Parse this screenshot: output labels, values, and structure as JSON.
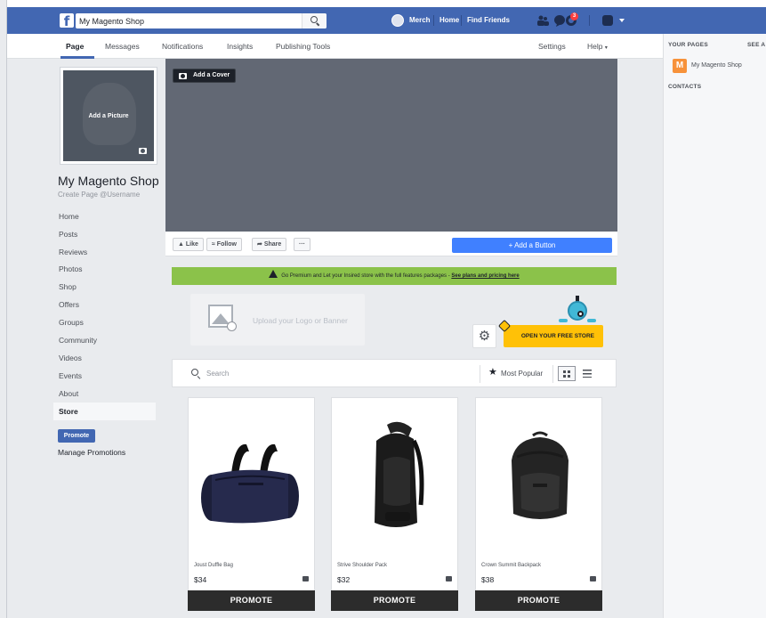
{
  "topbar": {
    "search_value": "My Magento Shop",
    "user_name": "Merch",
    "home_label": "Home",
    "find_friends_label": "Find Friends",
    "notification_count": "3"
  },
  "page_nav": {
    "tabs": [
      {
        "label": "Page"
      },
      {
        "label": "Messages"
      },
      {
        "label": "Notifications"
      },
      {
        "label": "Insights"
      },
      {
        "label": "Publishing Tools"
      }
    ],
    "settings_label": "Settings",
    "help_label": "Help",
    "help_caret": "▾"
  },
  "sidebar": {
    "add_picture_label": "Add a Picture",
    "page_name": "My Magento Shop",
    "username_prompt": "Create Page @Username",
    "items": [
      {
        "label": "Home"
      },
      {
        "label": "Posts"
      },
      {
        "label": "Reviews"
      },
      {
        "label": "Photos"
      },
      {
        "label": "Shop"
      },
      {
        "label": "Offers"
      },
      {
        "label": "Groups"
      },
      {
        "label": "Community"
      },
      {
        "label": "Videos"
      },
      {
        "label": "Events"
      },
      {
        "label": "About"
      },
      {
        "label": "Store"
      }
    ],
    "active_item": "Store",
    "promote_label": "Promote",
    "manage_promotions_label": "Manage Promotions"
  },
  "cover": {
    "add_cover_label": "Add a Cover"
  },
  "actions": {
    "like_label": "Like",
    "follow_label": "Follow",
    "share_label": "Share",
    "more_label": "···",
    "add_button_label": "+ Add a Button"
  },
  "premium_banner": {
    "text": "Go Premium and Let your Insired store with the full features packages - ",
    "link_text": "See plans and pricing here"
  },
  "store": {
    "upload_logo_label": "Upload your Logo or Banner",
    "open_store_label": "OPEN YOUR FREE STORE",
    "search_placeholder": "Search",
    "sort_label": "Most Popular",
    "products": [
      {
        "name": "Joust Duffle Bag",
        "price": "$34",
        "promote_label": "PROMOTE"
      },
      {
        "name": "Strive Shoulder Pack",
        "price": "$32",
        "promote_label": "PROMOTE"
      },
      {
        "name": "Crown Summit Backpack",
        "price": "$38",
        "promote_label": "PROMOTE"
      }
    ]
  },
  "rightcol": {
    "your_pages_label": "YOUR PAGES",
    "see_all_label": "SEE A",
    "page_initial": "M",
    "page_name": "My Magento Shop",
    "contacts_label": "CONTACTS"
  },
  "colors": {
    "facebook_blue": "#4267b2",
    "add_button_blue": "#4080ff",
    "premium_green": "#8bc24a",
    "store_yellow": "#ffc107",
    "cover_gray": "#626874",
    "page_background": "#e9ebee"
  },
  "icons": [
    "facebook-logo-icon",
    "search-icon",
    "friend-requests-icon",
    "messages-icon",
    "notifications-icon",
    "help-icon",
    "account-caret-icon",
    "camera-icon",
    "like-icon",
    "follow-icon",
    "share-icon",
    "warning-icon",
    "image-placeholder-icon",
    "gear-icon",
    "robot-mascot-icon",
    "star-icon",
    "grid-view-icon",
    "list-view-icon"
  ]
}
